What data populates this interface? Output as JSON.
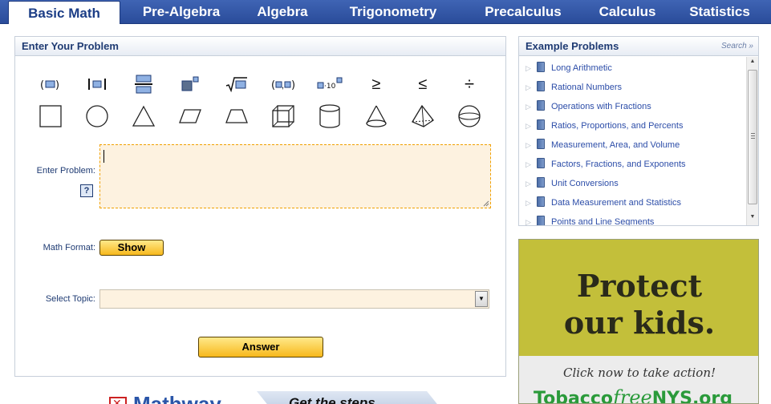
{
  "nav": {
    "tabs": [
      "Basic Math",
      "Pre-Algebra",
      "Algebra",
      "Trigonometry",
      "Precalculus",
      "Calculus",
      "Statistics"
    ]
  },
  "enter": {
    "title": "Enter Your Problem",
    "enter_label": "Enter Problem:",
    "help": "?",
    "format_label": "Math Format:",
    "show_btn": "Show",
    "topic_label": "Select Topic:",
    "answer_btn": "Answer",
    "sym_text": {
      "geq": "≥",
      "leq": "≤",
      "div": "÷"
    }
  },
  "examples": {
    "title": "Example Problems",
    "search": "Search »",
    "items": [
      "Long Arithmetic",
      "Rational Numbers",
      "Operations with Fractions",
      "Ratios, Proportions, and Percents",
      "Measurement, Area, and Volume",
      "Factors, Fractions, and Exponents",
      "Unit Conversions",
      "Data Measurement and Statistics",
      "Points and Line Segments"
    ]
  },
  "ad": {
    "line1": "Protect",
    "line2": "our kids.",
    "cta": "Click now to take action!",
    "brand_a": "Tobacco",
    "brand_b": "free",
    "brand_c": "NYS.org"
  },
  "footer": {
    "logo": "Mathway",
    "steps": "Get the steps"
  }
}
